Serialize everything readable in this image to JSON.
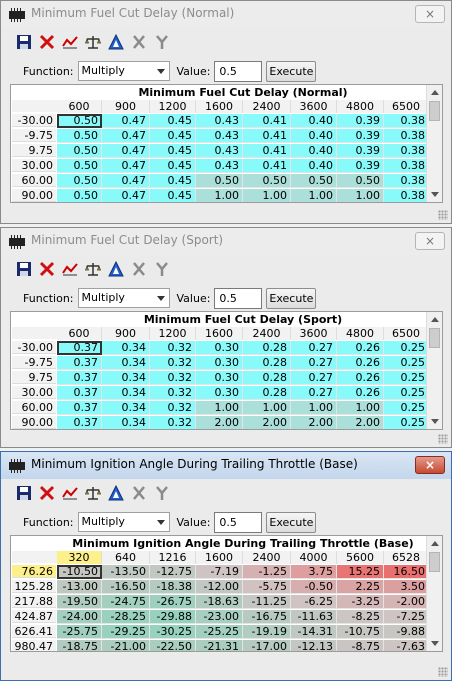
{
  "colors": {
    "cell_cyan": "#88fafa",
    "cell_mid": "#aadfda",
    "title_inactive": "#8c8c8c",
    "close_active": "#c64a33"
  },
  "toolbar_icons": [
    "save-icon",
    "delete-icon",
    "graph-icon",
    "scale-icon",
    "triangle-icon",
    "x-icon",
    "merge-icon"
  ],
  "windows": [
    {
      "title": "Minimum Fuel Cut Delay (Normal)",
      "close": "×",
      "function_label": "Function:",
      "function_value": "Multiply",
      "value_label": "Value:",
      "value": "0.5",
      "execute_label": "Execute",
      "table_title": "Minimum Fuel Cut Delay (Normal)",
      "columns": [
        "600",
        "900",
        "1200",
        "1600",
        "2400",
        "3600",
        "4800",
        "6500"
      ],
      "rows": [
        "-30.00",
        "-9.75",
        "9.75",
        "30.00",
        "60.00",
        "90.00"
      ],
      "cells": [
        [
          "0.50",
          "0.47",
          "0.45",
          "0.43",
          "0.41",
          "0.40",
          "0.39",
          "0.38"
        ],
        [
          "0.50",
          "0.47",
          "0.45",
          "0.43",
          "0.41",
          "0.40",
          "0.39",
          "0.38"
        ],
        [
          "0.50",
          "0.47",
          "0.45",
          "0.43",
          "0.41",
          "0.40",
          "0.39",
          "0.38"
        ],
        [
          "0.50",
          "0.47",
          "0.45",
          "0.43",
          "0.41",
          "0.40",
          "0.39",
          "0.38"
        ],
        [
          "0.50",
          "0.47",
          "0.45",
          "0.50",
          "0.50",
          "0.50",
          "0.50",
          "0.38"
        ],
        [
          "0.50",
          "0.47",
          "0.45",
          "1.00",
          "1.00",
          "1.00",
          "1.00",
          "0.38"
        ]
      ]
    },
    {
      "title": "Minimum Fuel Cut Delay (Sport)",
      "close": "×",
      "function_label": "Function:",
      "function_value": "Multiply",
      "value_label": "Value:",
      "value": "0.5",
      "execute_label": "Execute",
      "table_title": "Minimum Fuel Cut Delay (Sport)",
      "columns": [
        "600",
        "900",
        "1200",
        "1600",
        "2400",
        "3600",
        "4800",
        "6500"
      ],
      "rows": [
        "-30.00",
        "-9.75",
        "9.75",
        "30.00",
        "60.00",
        "90.00"
      ],
      "cells": [
        [
          "0.37",
          "0.34",
          "0.32",
          "0.30",
          "0.28",
          "0.27",
          "0.26",
          "0.25"
        ],
        [
          "0.37",
          "0.34",
          "0.32",
          "0.30",
          "0.28",
          "0.27",
          "0.26",
          "0.25"
        ],
        [
          "0.37",
          "0.34",
          "0.32",
          "0.30",
          "0.28",
          "0.27",
          "0.26",
          "0.25"
        ],
        [
          "0.37",
          "0.34",
          "0.32",
          "0.30",
          "0.28",
          "0.27",
          "0.26",
          "0.25"
        ],
        [
          "0.37",
          "0.34",
          "0.32",
          "1.00",
          "1.00",
          "1.00",
          "1.00",
          "0.25"
        ],
        [
          "0.37",
          "0.34",
          "0.32",
          "2.00",
          "2.00",
          "2.00",
          "2.00",
          "0.25"
        ]
      ]
    },
    {
      "title": "Minimum Ignition Angle During Trailing Throttle (Base)",
      "close": "×",
      "function_label": "Function:",
      "function_value": "Multiply",
      "value_label": "Value:",
      "value": "0.5",
      "execute_label": "Execute",
      "table_title": "Minimum Ignition Angle During Trailing Throttle (Base)",
      "columns": [
        "320",
        "640",
        "1216",
        "1600",
        "2400",
        "4000",
        "5600",
        "6528"
      ],
      "rows": [
        "76.26",
        "125.28",
        "217.88",
        "424.87",
        "626.41",
        "980.47"
      ],
      "cells": [
        [
          "-10.50",
          "-13.50",
          "-12.75",
          "-7.19",
          "-1.25",
          "3.75",
          "15.25",
          "16.50"
        ],
        [
          "-13.00",
          "-16.50",
          "-18.38",
          "-12.00",
          "-5.75",
          "-0.50",
          "2.25",
          "3.50"
        ],
        [
          "-19.50",
          "-24.75",
          "-26.75",
          "-18.63",
          "-11.25",
          "-6.25",
          "-3.25",
          "-2.00"
        ],
        [
          "-24.00",
          "-28.25",
          "-29.88",
          "-23.00",
          "-16.75",
          "-11.63",
          "-8.25",
          "-7.25"
        ],
        [
          "-25.75",
          "-29.25",
          "-30.25",
          "-25.25",
          "-19.19",
          "-14.31",
          "-10.75",
          "-9.88"
        ],
        [
          "-18.75",
          "-21.00",
          "-22.50",
          "-21.31",
          "-17.00",
          "-12.13",
          "-8.75",
          "-7.63"
        ]
      ]
    }
  ]
}
